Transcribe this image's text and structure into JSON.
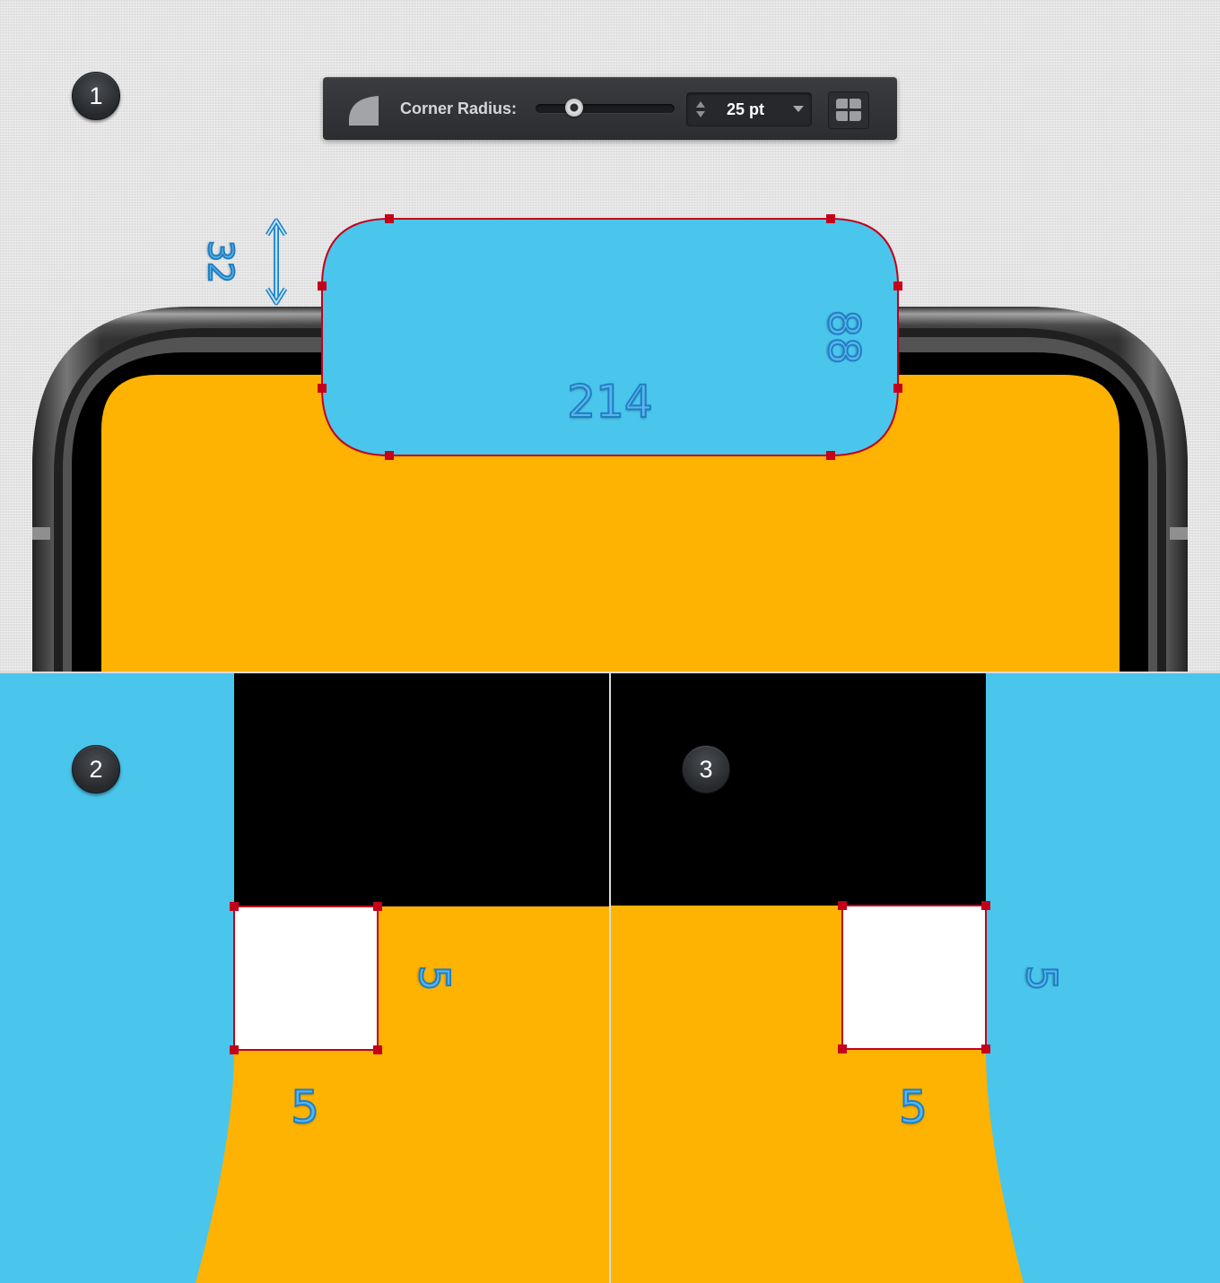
{
  "steps": {
    "one": "1",
    "two": "2",
    "three": "3"
  },
  "toolbar": {
    "corner_icon": "corner-shape-icon",
    "label": "Corner Radius:",
    "slider_level_fraction": 0.28,
    "value": "25 pt",
    "stepper_icon": "up-down-arrows-icon",
    "dropdown_icon": "chevron-down-icon",
    "grid_icon": "four-corners-grid-icon"
  },
  "measurements": {
    "notch_offset": "32",
    "notch_height": "88",
    "notch_width": "214",
    "step2_square_height": "5",
    "step2_square_width": "5",
    "step3_square_height": "5",
    "step3_square_width": "5"
  },
  "colors": {
    "blue_fill": "#4ac5ec",
    "yellow_screen": "#feb201",
    "anchor_red": "#c4001a",
    "background": "#e4e4e4",
    "toolbar_dark": "#333438",
    "measurement_blue": "#1f7fc4"
  }
}
